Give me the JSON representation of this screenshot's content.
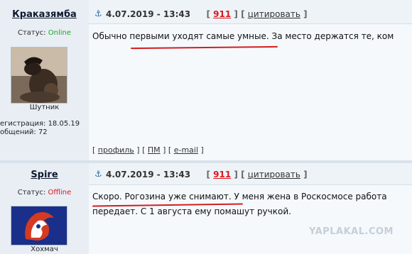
{
  "post1": {
    "author": "Краказямба",
    "status_label": "Статус:",
    "status_value": "Online",
    "avatar_caption": "Шутник",
    "registration": "егистрация: 18.05.19",
    "messages": "общений: 72",
    "date": "4.07.2019 - 13:43",
    "rating": "911",
    "cite_label": "цитировать",
    "text_line1": "Обычно первыми уходят самые умные. За место держатся те, ком",
    "footer_profile": "профиль",
    "footer_pm": "ПМ",
    "footer_email": "e-mail"
  },
  "post2": {
    "author": "Spire",
    "status_label": "Статус:",
    "status_value": "Offline",
    "avatar_caption": "Хохмач",
    "date": "4.07.2019 - 13:43",
    "rating": "911",
    "cite_label": "цитировать",
    "text_line1": "Скоро. Рогозина уже снимают. У меня жена в Роскосмосе работа",
    "text_line2": "передает. С 1 августа ему помашут ручкой."
  },
  "watermark": "YAPLAKAL.COM",
  "colors": {
    "online": "#19a72d",
    "offline": "#d7181e",
    "underline": "#d21e1e",
    "rating": "#d7181e"
  }
}
